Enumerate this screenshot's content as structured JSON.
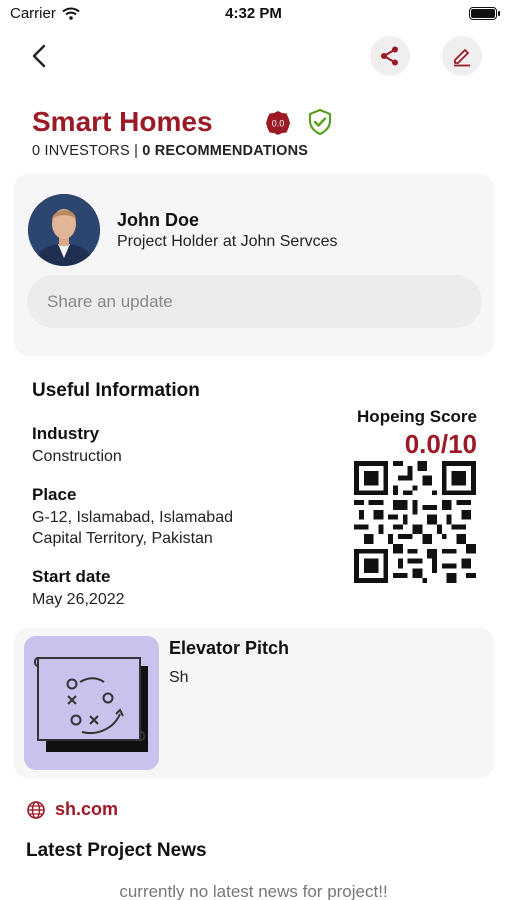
{
  "status_bar": {
    "carrier": "Carrier",
    "time": "4:32 PM"
  },
  "header": {
    "back_icon": "chevron-left-icon",
    "share_icon": "share-icon",
    "edit_icon": "pencil-icon"
  },
  "project": {
    "title": "Smart Homes",
    "score_badge": "0.0",
    "investors": "0 INVESTORS",
    "separator": "|",
    "recommendations": "0 RECOMMENDATIONS"
  },
  "holder": {
    "name": "John Doe",
    "role": "Project Holder at John Servces",
    "share_placeholder": "Share an update"
  },
  "useful_info": {
    "heading": "Useful Information",
    "industry_label": "Industry",
    "industry_value": "Construction",
    "place_label": "Place",
    "place_line1": "G-12, Islamabad, Islamabad",
    "place_line2": "Capital Territory, Pakistan",
    "start_label": "Start date",
    "start_value": "May 26,2022"
  },
  "hopeing": {
    "title": "Hopeing Score",
    "value": "0.0/10"
  },
  "pitch": {
    "title": "Elevator Pitch",
    "text": "Sh"
  },
  "website": {
    "url": "sh.com"
  },
  "news": {
    "heading": "Latest Project News",
    "empty": "currently no latest news for project!!"
  },
  "colors": {
    "brand": "#9c1a26",
    "verified": "#5aa020",
    "card_bg": "#f7f6f6",
    "thumb_bg": "#c9c2ec"
  }
}
